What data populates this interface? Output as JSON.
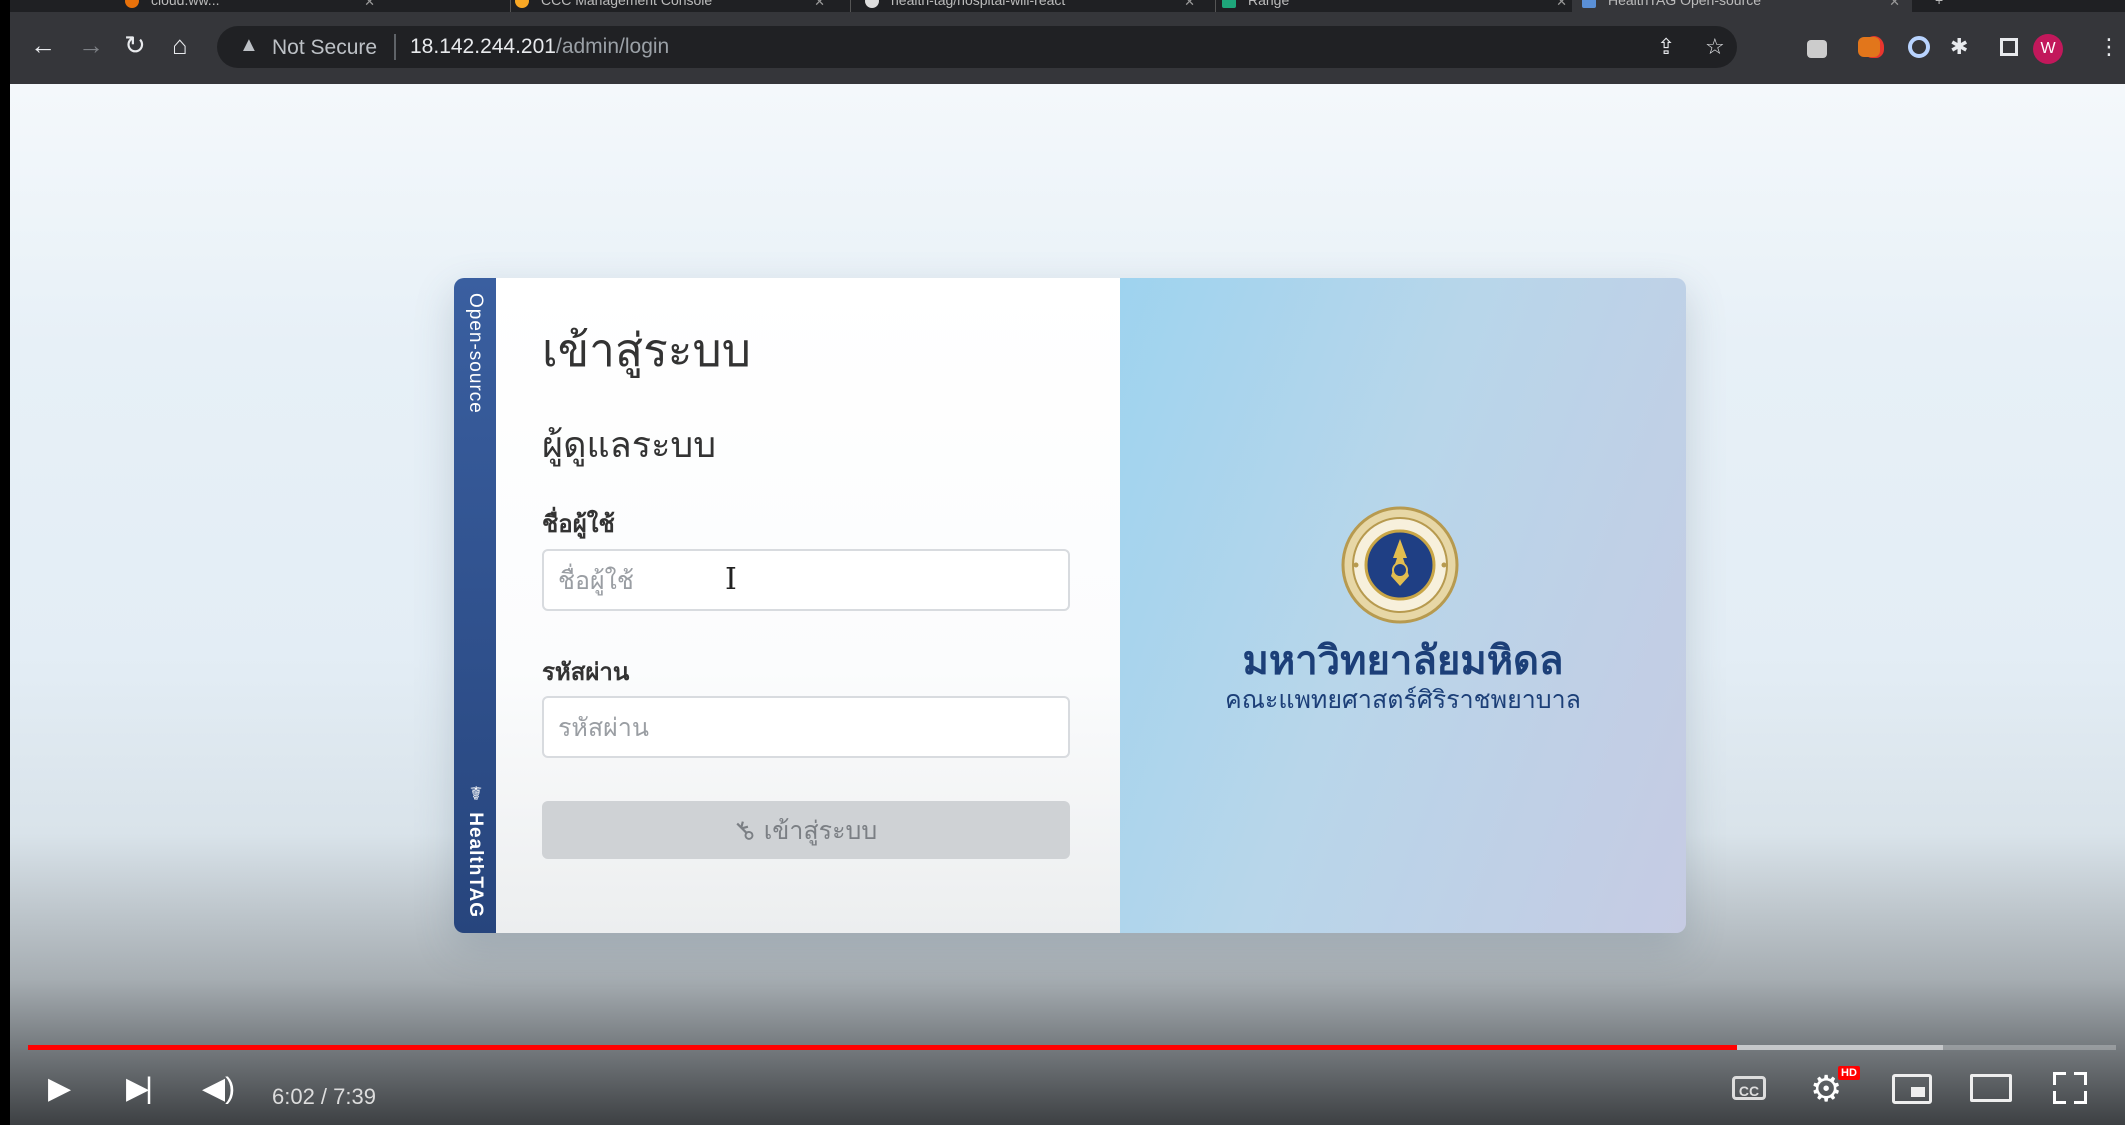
{
  "browser": {
    "tabs": [
      {
        "label": "cloud.ww..."
      },
      {
        "label": "CCC Management Console"
      },
      {
        "label": "health-tag/hospital-will-react"
      },
      {
        "label": "Range"
      },
      {
        "label": "HealthTAG Open-source"
      }
    ],
    "security_label": "Not Secure",
    "url_host": "18.142.244.201",
    "url_path": "/admin/login",
    "profile_initial": "W"
  },
  "login": {
    "title": "เข้าสู่ระบบ",
    "subtitle": "ผู้ดูแลระบบ",
    "username_label": "ชื่อผู้ใช้",
    "username_placeholder": "ชื่อผู้ใช้",
    "password_label": "รหัสผ่าน",
    "password_placeholder": "รหัสผ่าน",
    "submit_label": "เข้าสู่ระบบ",
    "ribbon_top": "Open-source",
    "ribbon_bottom": "☤ HealthTAG"
  },
  "branding": {
    "university_name": "มหาวิทยาลัยมหิดล",
    "faculty_name": "คณะแพทยศาสตร์ศิริราชพยาบาล"
  },
  "player": {
    "time_display": "6:02 / 7:39",
    "progress_fraction": 0.8186,
    "buffered_fraction": 0.917,
    "hd_label": "HD",
    "cc_label": "CC",
    "accent_color": "#ff0000"
  }
}
